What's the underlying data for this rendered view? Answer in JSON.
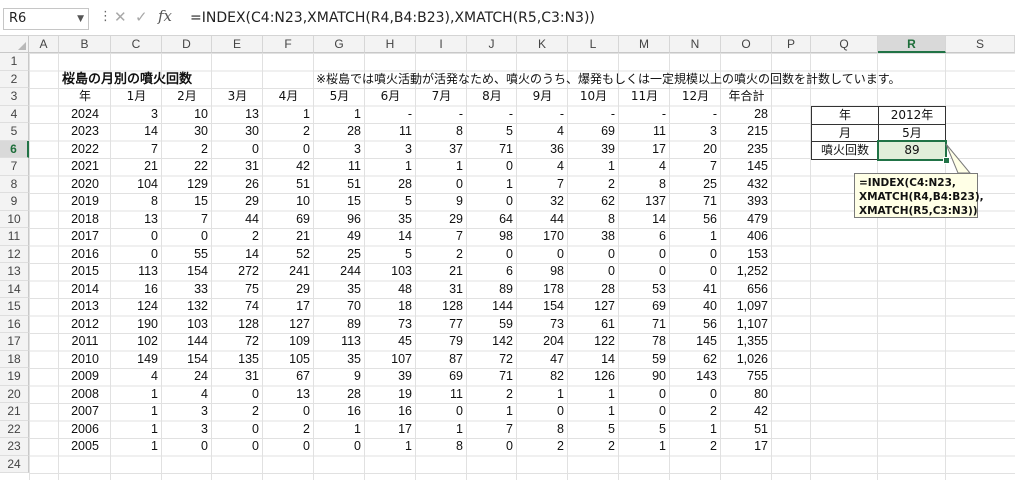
{
  "formula_bar": {
    "name_box": "R6",
    "formula": "=INDEX(C4:N23,XMATCH(R4,B4:B23),XMATCH(R5,C3:N3))"
  },
  "column_headers": [
    "A",
    "B",
    "C",
    "D",
    "E",
    "F",
    "G",
    "H",
    "I",
    "J",
    "K",
    "L",
    "M",
    "N",
    "O",
    "P",
    "Q",
    "R",
    "S"
  ],
  "row_headers": [
    "1",
    "2",
    "3",
    "4",
    "5",
    "6",
    "7",
    "8",
    "9",
    "10",
    "11",
    "12",
    "13",
    "14",
    "15",
    "16",
    "17",
    "18",
    "19",
    "20",
    "21",
    "22",
    "23",
    "24"
  ],
  "sheet": {
    "title": "桜島の月別の噴火回数",
    "note": "※桜島では噴火活動が活発なため、噴火のうち、爆発もしくは一定規模以上の噴火の回数を計数しています。",
    "headers": [
      "年",
      "1月",
      "2月",
      "3月",
      "4月",
      "5月",
      "6月",
      "7月",
      "8月",
      "9月",
      "10月",
      "11月",
      "12月",
      "年合計"
    ],
    "rows": [
      [
        "2024",
        "3",
        "10",
        "13",
        "1",
        "1",
        "-",
        "-",
        "-",
        "-",
        "-",
        "-",
        "-",
        "28"
      ],
      [
        "2023",
        "14",
        "30",
        "30",
        "2",
        "28",
        "11",
        "8",
        "5",
        "4",
        "69",
        "11",
        "3",
        "215"
      ],
      [
        "2022",
        "7",
        "2",
        "0",
        "0",
        "3",
        "3",
        "37",
        "71",
        "36",
        "39",
        "17",
        "20",
        "235"
      ],
      [
        "2021",
        "21",
        "22",
        "31",
        "42",
        "11",
        "1",
        "1",
        "0",
        "4",
        "1",
        "4",
        "7",
        "145"
      ],
      [
        "2020",
        "104",
        "129",
        "26",
        "51",
        "51",
        "28",
        "0",
        "1",
        "7",
        "2",
        "8",
        "25",
        "432"
      ],
      [
        "2019",
        "8",
        "15",
        "29",
        "10",
        "15",
        "5",
        "9",
        "0",
        "32",
        "62",
        "137",
        "71",
        "393"
      ],
      [
        "2018",
        "13",
        "7",
        "44",
        "69",
        "96",
        "35",
        "29",
        "64",
        "44",
        "8",
        "14",
        "56",
        "479"
      ],
      [
        "2017",
        "0",
        "0",
        "2",
        "21",
        "49",
        "14",
        "7",
        "98",
        "170",
        "38",
        "6",
        "1",
        "406"
      ],
      [
        "2016",
        "0",
        "55",
        "14",
        "52",
        "25",
        "5",
        "2",
        "0",
        "0",
        "0",
        "0",
        "0",
        "153"
      ],
      [
        "2015",
        "113",
        "154",
        "272",
        "241",
        "244",
        "103",
        "21",
        "6",
        "98",
        "0",
        "0",
        "0",
        "1,252"
      ],
      [
        "2014",
        "16",
        "33",
        "75",
        "29",
        "35",
        "48",
        "31",
        "89",
        "178",
        "28",
        "53",
        "41",
        "656"
      ],
      [
        "2013",
        "124",
        "132",
        "74",
        "17",
        "70",
        "18",
        "128",
        "144",
        "154",
        "127",
        "69",
        "40",
        "1,097"
      ],
      [
        "2012",
        "190",
        "103",
        "128",
        "127",
        "89",
        "73",
        "77",
        "59",
        "73",
        "61",
        "71",
        "56",
        "1,107"
      ],
      [
        "2011",
        "102",
        "144",
        "72",
        "109",
        "113",
        "45",
        "79",
        "142",
        "204",
        "122",
        "78",
        "145",
        "1,355"
      ],
      [
        "2010",
        "149",
        "154",
        "135",
        "105",
        "35",
        "107",
        "87",
        "72",
        "47",
        "14",
        "59",
        "62",
        "1,026"
      ],
      [
        "2009",
        "4",
        "24",
        "31",
        "67",
        "9",
        "39",
        "69",
        "71",
        "82",
        "126",
        "90",
        "143",
        "755"
      ],
      [
        "2008",
        "1",
        "4",
        "0",
        "13",
        "28",
        "19",
        "11",
        "2",
        "1",
        "1",
        "0",
        "0",
        "80"
      ],
      [
        "2007",
        "1",
        "3",
        "2",
        "0",
        "16",
        "16",
        "0",
        "1",
        "0",
        "1",
        "0",
        "2",
        "42"
      ],
      [
        "2006",
        "1",
        "3",
        "0",
        "2",
        "1",
        "17",
        "1",
        "7",
        "8",
        "5",
        "5",
        "1",
        "51"
      ],
      [
        "2005",
        "1",
        "0",
        "0",
        "0",
        "0",
        "1",
        "8",
        "0",
        "2",
        "2",
        "1",
        "2",
        "17"
      ]
    ]
  },
  "lookup": {
    "year_label": "年",
    "year_value": "2012年",
    "month_label": "月",
    "month_value": "5月",
    "result_label": "噴火回数",
    "result_value": "89"
  },
  "callout": {
    "line1": "=INDEX(C4:N23,",
    "line2": "XMATCH(R4,B4:B23),",
    "line3": "XMATCH(R5,C3:N3))"
  },
  "colors": {
    "selection": "#217346",
    "result_fill": "#e2efda",
    "callout_fill": "#ffffe6"
  }
}
